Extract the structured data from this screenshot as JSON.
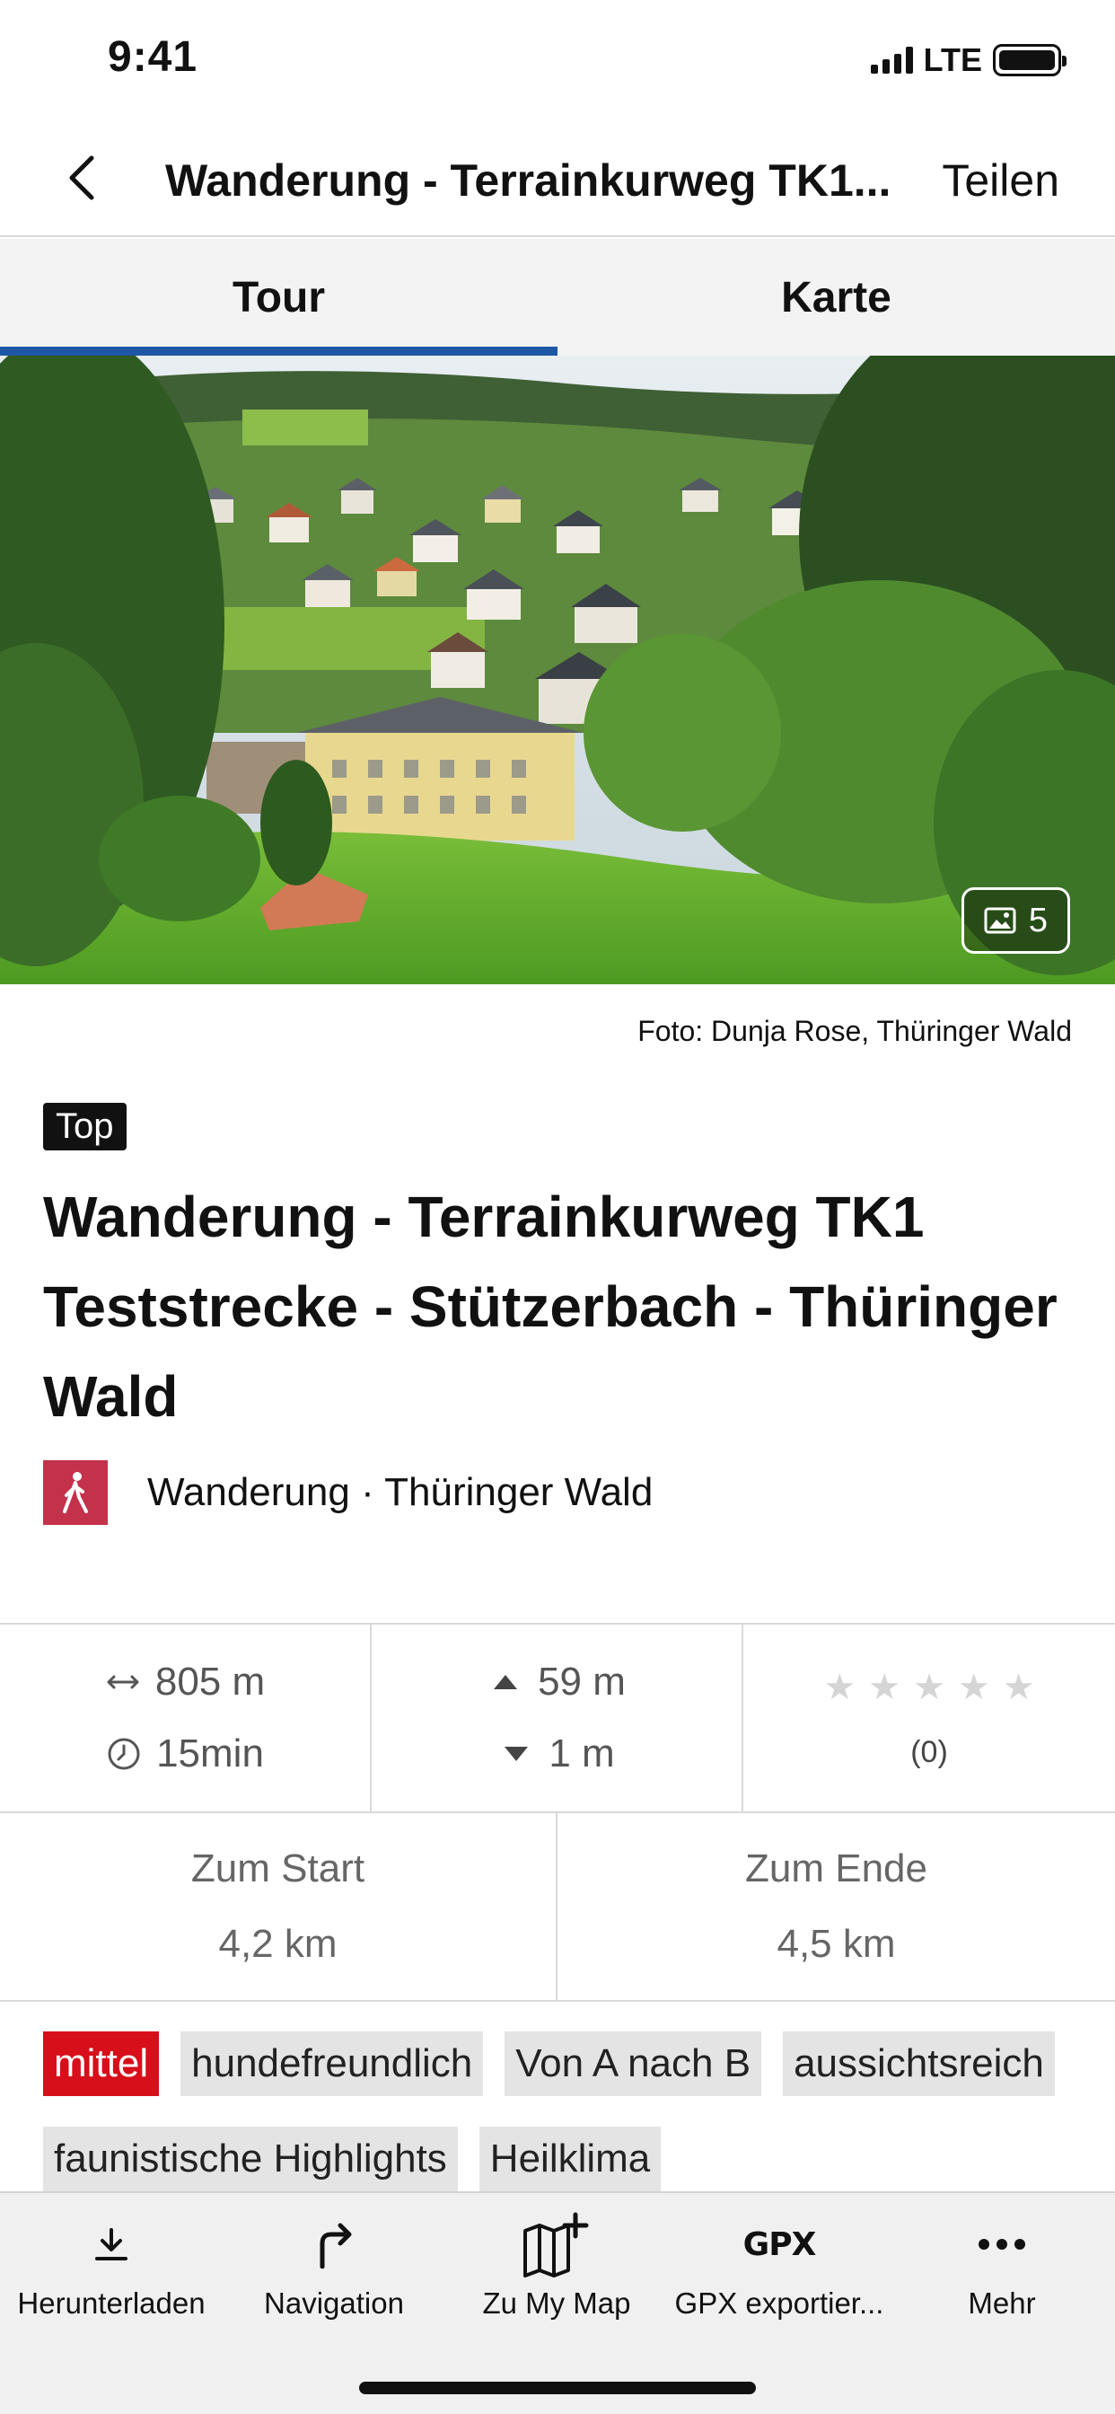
{
  "status_bar": {
    "time": "9:41",
    "network": "LTE"
  },
  "header": {
    "title": "Wanderung - Terrainkurweg TK1...",
    "share_label": "Teilen"
  },
  "tabs": [
    {
      "label": "Tour",
      "active": true
    },
    {
      "label": "Karte",
      "active": false
    }
  ],
  "hero": {
    "photo_count": "5",
    "credit": "Foto: Dunja Rose, Thüringer Wald"
  },
  "tour": {
    "badge": "Top",
    "title": "Wanderung - Terrainkurweg TK1 Teststrecke - Stützerbach - Thüringer Wald",
    "category": "Wanderung · Thüringer Wald",
    "category_color": "#c4314b"
  },
  "stats": {
    "distance": "805 m",
    "duration": "15min",
    "ascent": "59 m",
    "descent": "1 m",
    "rating_stars": 0,
    "rating_count": "(0)"
  },
  "distances": {
    "start_label": "Zum Start",
    "start_value": "4,2 km",
    "end_label": "Zum Ende",
    "end_value": "4,5 km"
  },
  "tags": [
    {
      "label": "mittel",
      "color": "#d60f1a"
    },
    {
      "label": "hundefreundlich"
    },
    {
      "label": "Von A nach B"
    },
    {
      "label": "aussichtsreich"
    },
    {
      "label": "faunistische Highlights"
    },
    {
      "label": "Heilklima"
    }
  ],
  "toolbar": {
    "items": [
      {
        "label": "Herunterladen",
        "icon": "download-icon"
      },
      {
        "label": "Navigation",
        "icon": "turn-right-arrow-icon"
      },
      {
        "label": "Zu My Map",
        "icon": "map-add-icon"
      },
      {
        "label": "GPX exportier...",
        "icon": "gpx-icon",
        "glyph": "GPX"
      },
      {
        "label": "Mehr",
        "icon": "more-dots-icon"
      }
    ]
  },
  "colors": {
    "accent": "#1f57a7",
    "difficulty": "#d60f1a"
  }
}
